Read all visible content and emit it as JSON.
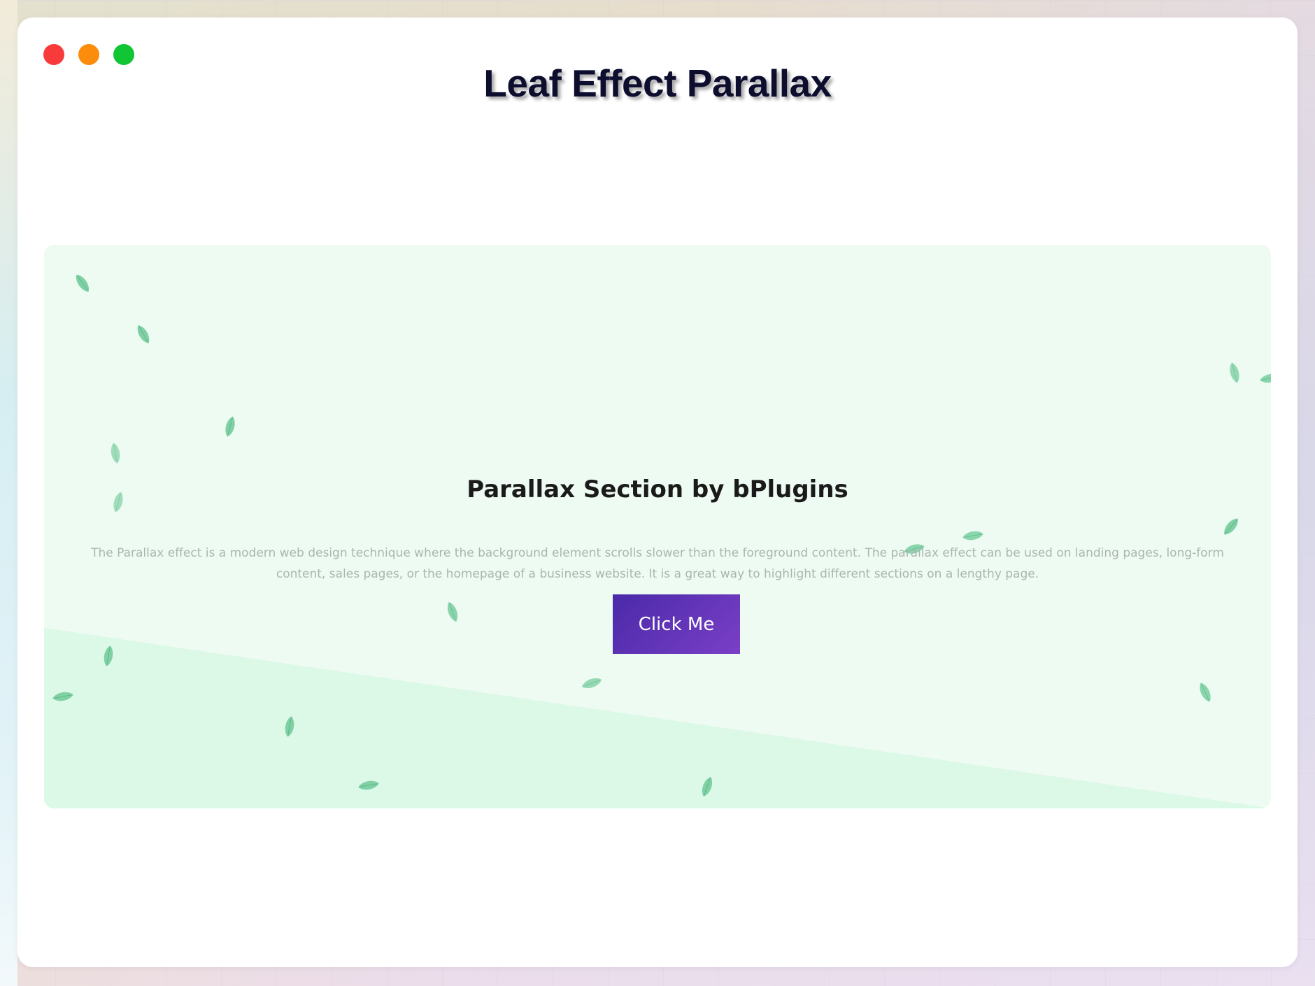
{
  "window": {
    "controls": [
      "close",
      "minimize",
      "maximize"
    ]
  },
  "page": {
    "title": "Leaf Effect Parallax"
  },
  "section": {
    "heading": "Parallax Section by bPlugins",
    "description": "The Parallax effect is a modern web design technique where the background element scrolls slower than the foreground content. The parallax effect can be used on landing pages, long-form content, sales pages, or the homepage of a business website. It is a great way to highlight different sections on a lengthy page.",
    "button_label": "Click Me",
    "leaf_icon": "leaf-icon"
  },
  "colors": {
    "close": "#f93a3a",
    "minimize": "#fb8c0c",
    "maximize": "#12c534",
    "section_bg": "#eefbf2",
    "wave": "#dcf8e6",
    "leaf": "#7fd1a5",
    "button_start": "#4a2aa8",
    "button_end": "#7a3fc6"
  }
}
